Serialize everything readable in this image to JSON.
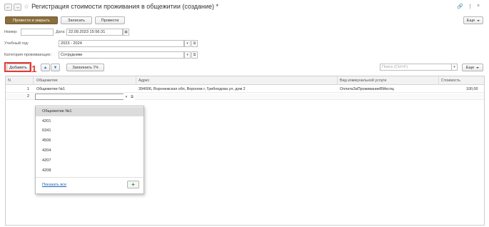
{
  "window": {
    "title": "Регистрация стоимости проживания в общежитии (создание) *",
    "back_icon": "←",
    "forward_icon": "→",
    "star_icon": "☆",
    "link_icon": "🔗",
    "menu_icon": "⋮",
    "close_icon": "×"
  },
  "toolbar": {
    "post_close": "Провести и закрыть",
    "save": "Записать",
    "post": "Провести",
    "more": "Еще"
  },
  "form": {
    "number_label": "Номер:",
    "number_value": "",
    "date_label": "Дата:",
    "date_value": "22.09.2023 15:56:31",
    "year_label": "Учебный год:",
    "year_value": "2023 - 2024",
    "category_label": "Категория проживающих:",
    "category_value": "Сотрудники"
  },
  "table_toolbar": {
    "add": "Добавить",
    "fill": "Заполнить ТЧ",
    "search_placeholder": "Поиск (Ctrl+F)",
    "more": "Еще",
    "marker": "1"
  },
  "table": {
    "columns": [
      "N",
      "Общежитие",
      "Адрес",
      "Вид коммунальной услуги",
      "Стоимость"
    ],
    "rows": [
      {
        "n": "1",
        "dorm": "Общежитие №1",
        "address": "394006, Воронежская обл, Воронеж г, Грибоедова ул, дом 2",
        "service": "ОплатаЗаПроживаниеВМесяц",
        "cost": "100,00"
      },
      {
        "n": "2",
        "dorm": "",
        "address": "",
        "service": "",
        "cost": ""
      }
    ]
  },
  "dropdown": {
    "items": [
      "Общежитие №1",
      "4201",
      "6341",
      "4506",
      "4204",
      "4207",
      "4208"
    ],
    "show_all": "Показать все",
    "add_icon": "+"
  }
}
